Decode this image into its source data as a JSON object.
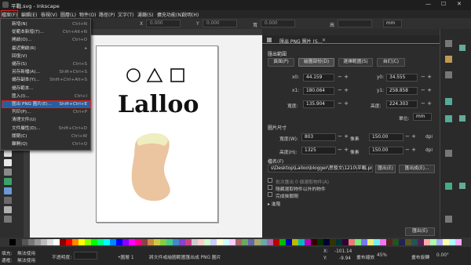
{
  "window": {
    "title": "平戰.svg - Inkscape",
    "minimize": "—",
    "maximize": "☐",
    "close": "✕"
  },
  "menubar": [
    "檔案(F)",
    "編輯(E)",
    "檢視(V)",
    "圖層(L)",
    "物件(O)",
    "路徑(P)",
    "文字(T)",
    "濾鏡(S)",
    "擴充功能(N)",
    "說明(H)"
  ],
  "file_menu": [
    {
      "label": "新增(N)",
      "shortcut": "Ctrl+N"
    },
    {
      "label": "從範本新增(T)...",
      "shortcut": "Ctrl+Alt+N"
    },
    {
      "label": "開啟(O)...",
      "shortcut": "Ctrl+O"
    },
    {
      "label": "最近開啟(R)",
      "shortcut": "▸"
    },
    {
      "label": "回復(V)",
      "shortcut": ""
    },
    {
      "label": "儲存(S)",
      "shortcut": "Ctrl+S"
    },
    {
      "label": "另存新檔(A)...",
      "shortcut": "Shift+Ctrl+S"
    },
    {
      "label": "儲存副本(Y)...",
      "shortcut": "Shift+Ctrl+Alt+S"
    },
    {
      "label": "儲存範本...",
      "shortcut": ""
    },
    {
      "label": "匯入(I)...",
      "shortcut": "Ctrl+I"
    },
    {
      "label": "匯出 PNG 圖片(E)...",
      "shortcut": "Shift+Ctrl+E"
    },
    {
      "label": "列印(P)...",
      "shortcut": "Ctrl+P"
    },
    {
      "label": "清理文件(U)",
      "shortcut": ""
    },
    {
      "label": "文件屬性(D)...",
      "shortcut": "Shift+Ctrl+D"
    },
    {
      "label": "關閉(C)",
      "shortcut": "Ctrl+W"
    },
    {
      "label": "離開(Q)",
      "shortcut": "Ctrl+Q"
    }
  ],
  "file_menu_highlighted": 10,
  "commandbar": {
    "x_label": "X",
    "x_value": "0.000",
    "y_label": "Y",
    "y_value": "0.000",
    "w_label": "寬",
    "w_value": "0.000",
    "h_label": "高",
    "unit": "mm"
  },
  "canvas": {
    "text": "Lalloo"
  },
  "dock": {
    "tab_title": "匯出 PNG 圖片 (S...",
    "tab_close": "✕",
    "section_export_area": "匯出範圍",
    "area_tabs": [
      "頁面(P)",
      "繪圖部份(D)",
      "選擇範圍(S)",
      "自訂(C)"
    ],
    "area_active": 1,
    "x0_label": "x0:",
    "x0_value": "44.159",
    "y0_label": "y0:",
    "y0_value": "34.555",
    "x1_label": "x1:",
    "x1_value": "180.064",
    "y1_label": "y1:",
    "y1_value": "258.858",
    "width_label": "寬度:",
    "width_value": "135.904",
    "height_label": "高度:",
    "height_value": "224.303",
    "units_label": "單位:",
    "units_value": "mm",
    "section_image_size": "圖片尺寸",
    "img_w_label": "寬度(W):",
    "img_w_value": "803",
    "at_label": "像素",
    "dpi_value": "150.00",
    "dpi_label": "dpi",
    "img_h_label": "高度(H):",
    "img_h_value": "1325",
    "at2_label": "像素",
    "dpi2_value": "150.00",
    "dpi2_label": "dpi",
    "section_filename": "檔名(F)",
    "filename_value": "s\\Desktop\\Lalloo\\blogger\\思發文\\1210\\平戰.png",
    "export_as_button": "匯出(E)",
    "export_as_button2": "匯出成(E)...",
    "opt1": "批次匯出 0 個選取物件(A)",
    "opt2": "隱藏選取物件以外的物件",
    "opt3": "完成後關閉",
    "advanced": "▸ 進階",
    "export_button": "匯出(E)"
  },
  "statusbar": {
    "fill_label": "填充:",
    "fill_value": "無法使用",
    "stroke_label": "邊框:",
    "stroke_value": "無法使用",
    "opacity_label": "不透明度:",
    "layer": "•圖層 1",
    "message": "將文件或繪圖範圍匯出成 PNG 圖片",
    "x_label": "X:",
    "x_value": "-101.14",
    "y_label": "Y:",
    "y_value": "-9.94",
    "zoom_label": "畫布縮放",
    "zoom_value": "45%",
    "rotate_label": "畫布旋轉",
    "rotate_value": "0.00°"
  },
  "colors": {
    "accent": "#2a5d9f",
    "highlight_outline": "#e02020",
    "bean": "#ebc5a0",
    "bean_top": "#eeeec0"
  }
}
